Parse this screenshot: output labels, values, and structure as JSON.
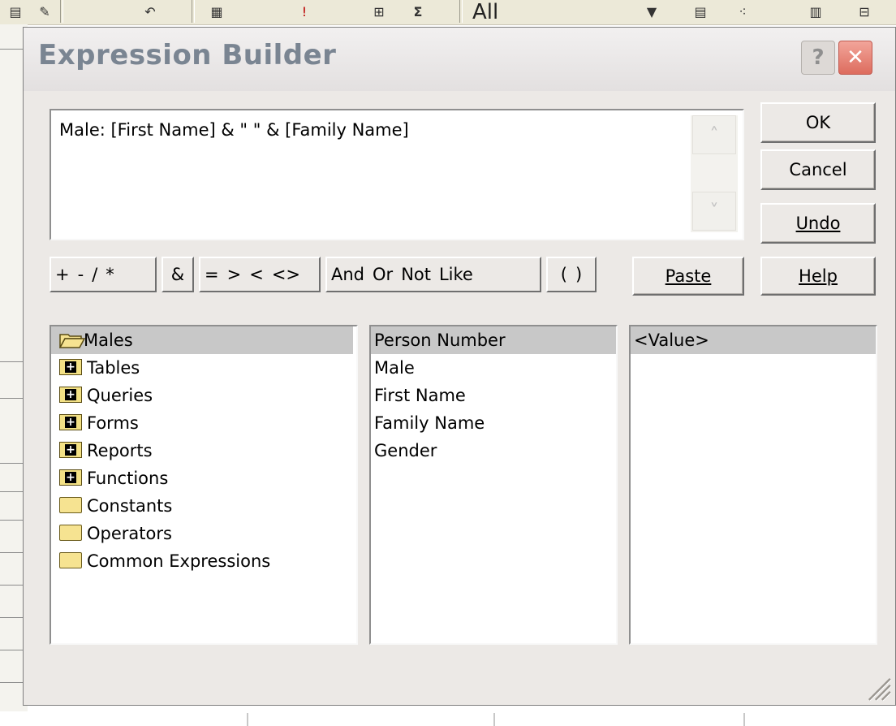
{
  "dialog": {
    "title": "Expression Builder",
    "help_glyph": "?",
    "close_glyph": "✕"
  },
  "expression": {
    "text": "Male: [First Name] & \" \" & [Family Name]",
    "scroll_up": "˄",
    "scroll_down": "˅"
  },
  "buttons": {
    "ok": "OK",
    "cancel": "Cancel",
    "undo": "Undo",
    "paste": "Paste",
    "help": "Help"
  },
  "operators": {
    "group1": [
      "+",
      "-",
      "/",
      "*"
    ],
    "amp": "&",
    "group2": [
      "=",
      ">",
      "<",
      "<>"
    ],
    "group3": [
      "And",
      "Or",
      "Not",
      "Like"
    ],
    "group4": [
      "(",
      ")"
    ]
  },
  "tree": {
    "items": [
      {
        "label": "Males",
        "icon": "folder-open-icon"
      },
      {
        "label": "Tables",
        "icon": "folder-plus-icon"
      },
      {
        "label": "Queries",
        "icon": "folder-plus-icon"
      },
      {
        "label": "Forms",
        "icon": "folder-plus-icon"
      },
      {
        "label": "Reports",
        "icon": "folder-plus-icon"
      },
      {
        "label": "Functions",
        "icon": "folder-plus-icon"
      },
      {
        "label": "Constants",
        "icon": "folder-icon"
      },
      {
        "label": "Operators",
        "icon": "folder-icon"
      },
      {
        "label": "Common Expressions",
        "icon": "folder-icon"
      }
    ]
  },
  "fields": {
    "items": [
      "Person Number",
      "Male",
      "First Name",
      "Family Name",
      "Gender"
    ]
  },
  "values": {
    "items": [
      "<Value>"
    ]
  },
  "background": {
    "toolbar_text": "All"
  }
}
